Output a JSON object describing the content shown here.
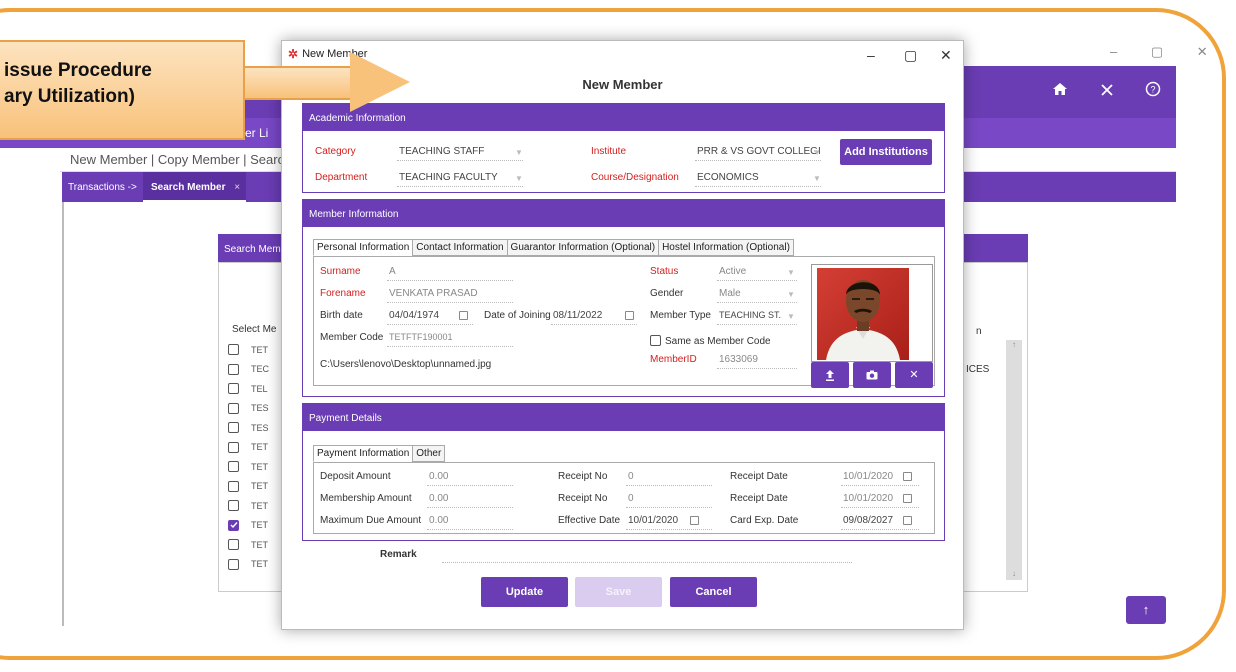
{
  "callout": {
    "line1": "issue Procedure",
    "line2": "ary Utilization)"
  },
  "background": {
    "window_controls": [
      "–",
      "▢",
      "✕"
    ],
    "header_icons": [
      "home-icon",
      "close-icon",
      "help-icon"
    ],
    "subbar_partial": "nter Li",
    "menu": "New Member | Copy Member | Searc",
    "breadcrumb_root": "Transactions ->",
    "active_tab": "Search Member",
    "tab_close": "×",
    "search_panel_title": "Search Memb",
    "column_select": "Select",
    "column_partial": "Me",
    "column_right_partial": "n",
    "side_text": "ICES",
    "rows": [
      {
        "code": "TET",
        "checked": false
      },
      {
        "code": "TEC",
        "checked": false
      },
      {
        "code": "TEL",
        "checked": false
      },
      {
        "code": "TES",
        "checked": false
      },
      {
        "code": "TES",
        "checked": false
      },
      {
        "code": "TET",
        "checked": false
      },
      {
        "code": "TET",
        "checked": false
      },
      {
        "code": "TET",
        "checked": false
      },
      {
        "code": "TET",
        "checked": false
      },
      {
        "code": "TET",
        "checked": true
      },
      {
        "code": "TET",
        "checked": false
      },
      {
        "code": "TET",
        "checked": false
      }
    ],
    "scroll_up": "↑"
  },
  "modal": {
    "window_title": "New Member",
    "heading": "New Member",
    "academic": {
      "title": "Academic Information",
      "category_label": "Category",
      "category_value": "TEACHING STAFF",
      "institute_label": "Institute",
      "institute_value": "PRR & VS GOVT COLLEGI",
      "add_institutions": "Add Institutions",
      "department_label": "Department",
      "department_value": "TEACHING FACULTY",
      "course_label": "Course/Designation",
      "course_value": "ECONOMICS"
    },
    "member": {
      "title": "Member Information",
      "tabs": [
        "Personal Information",
        "Contact Information",
        "Guarantor Information (Optional)",
        "Hostel Information (Optional)"
      ],
      "surname_label": "Surname",
      "surname_value": "A",
      "forename_label": "Forename",
      "forename_value": "VENKATA PRASAD",
      "birth_label": "Birth date",
      "birth_value": "04/04/1974",
      "joining_label": "Date of Joining",
      "joining_value": "08/11/2022",
      "code_label": "Member Code",
      "code_value": "TETFTF190001",
      "path_value": "C:\\Users\\lenovo\\Desktop\\unnamed.jpg",
      "status_label": "Status",
      "status_value": "Active",
      "gender_label": "Gender",
      "gender_value": "Male",
      "type_label": "Member Type",
      "type_value": "TEACHING ST.",
      "same_as_label": "Same as Member Code",
      "memberid_label": "MemberID",
      "memberid_value": "1633069",
      "photo_buttons": [
        "upload-icon",
        "camera-icon",
        "remove-icon"
      ]
    },
    "payment": {
      "title": "Payment Details",
      "tabs": [
        "Payment Information",
        "Other"
      ],
      "deposit_label": "Deposit Amount",
      "deposit_value": "0.00",
      "membership_label": "Membership Amount",
      "membership_value": "0.00",
      "maxdue_label": "Maximum Due Amount",
      "maxdue_value": "0.00",
      "receipt1_label": "Receipt No",
      "receipt1_value": "0",
      "receipt2_label": "Receipt No",
      "receipt2_value": "0",
      "effective_label": "Effective Date",
      "effective_value": "10/01/2020",
      "rdate1_label": "Receipt Date",
      "rdate1_value": "10/01/2020",
      "rdate2_label": "Receipt Date",
      "rdate2_value": "10/01/2020",
      "cardexp_label": "Card Exp. Date",
      "cardexp_value": "09/08/2027"
    },
    "remark_label": "Remark",
    "buttons": {
      "update": "Update",
      "save": "Save",
      "cancel": "Cancel"
    }
  },
  "colors": {
    "accent": "#6a3db4",
    "required_label": "#d32020",
    "callout_border": "#f0a33a"
  }
}
